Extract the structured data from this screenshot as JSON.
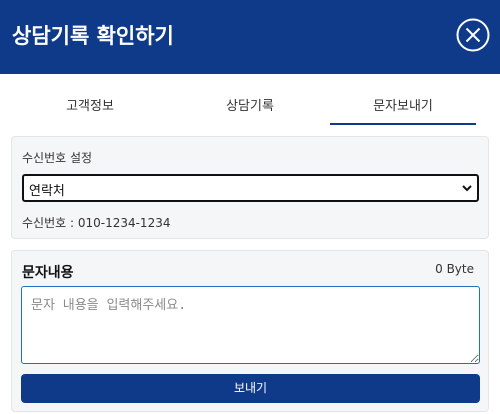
{
  "header": {
    "title": "상담기록 확인하기",
    "close_icon": "close-icon"
  },
  "tabs": [
    {
      "label": "고객정보",
      "active": false
    },
    {
      "label": "상담기록",
      "active": false
    },
    {
      "label": "문자보내기",
      "active": true
    }
  ],
  "recipient": {
    "section_label": "수신번호 설정",
    "select_value": "연락처",
    "number_text": "수신번호 : 010-1234-1234"
  },
  "message": {
    "title": "문자내용",
    "byte_count": "0 Byte",
    "placeholder": "문자 내용을 입력해주세요.",
    "send_label": "보내기"
  },
  "colors": {
    "primary": "#0f3a8a",
    "card_bg": "#f5f6f8",
    "focus_border": "#1e73be"
  }
}
